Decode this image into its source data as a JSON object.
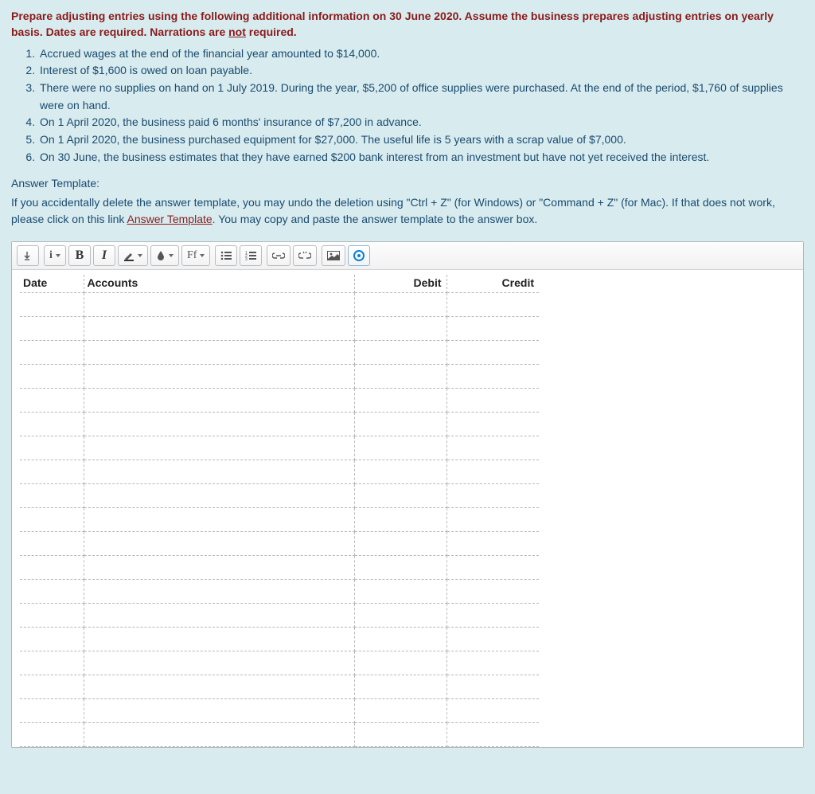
{
  "instructions": {
    "prefix": "Prepare adjusting entries using the following additional information on 30 June 2020. Assume the business prepares adjusting entries on yearly basis. Dates are required. Narrations are ",
    "not_word": "not",
    "suffix": " required."
  },
  "facts": [
    "Accrued wages at the end of the financial year amounted to $14,000.",
    "Interest of $1,600 is owed on loan payable.",
    "There were no supplies on hand on 1 July 2019. During the year, $5,200 of office supplies were purchased. At the end of the period, $1,760 of supplies were on hand.",
    "On 1 April 2020, the business paid 6 months' insurance of $7,200 in advance.",
    "On 1 April 2020, the business purchased equipment for $27,000. The useful life is 5 years with a scrap value of $7,000.",
    "On 30 June, the business estimates that they have earned $200 bank interest from an investment but have not yet received the interest."
  ],
  "answer_template_label": "Answer Template:",
  "template_help": {
    "before_link": "If you accidentally delete the answer template, you may undo the deletion using \"Ctrl + Z\" (for Windows) or \"Command + Z\" (for Mac). If that does not work, please click on this link ",
    "link_text": "Answer Template",
    "after_link": ". You may copy and paste the answer template to the answer box."
  },
  "toolbar": {
    "font_label": "Ff"
  },
  "table": {
    "headers": {
      "date": "Date",
      "accounts": "Accounts",
      "debit": "Debit",
      "credit": "Credit"
    },
    "row_count": 19
  }
}
